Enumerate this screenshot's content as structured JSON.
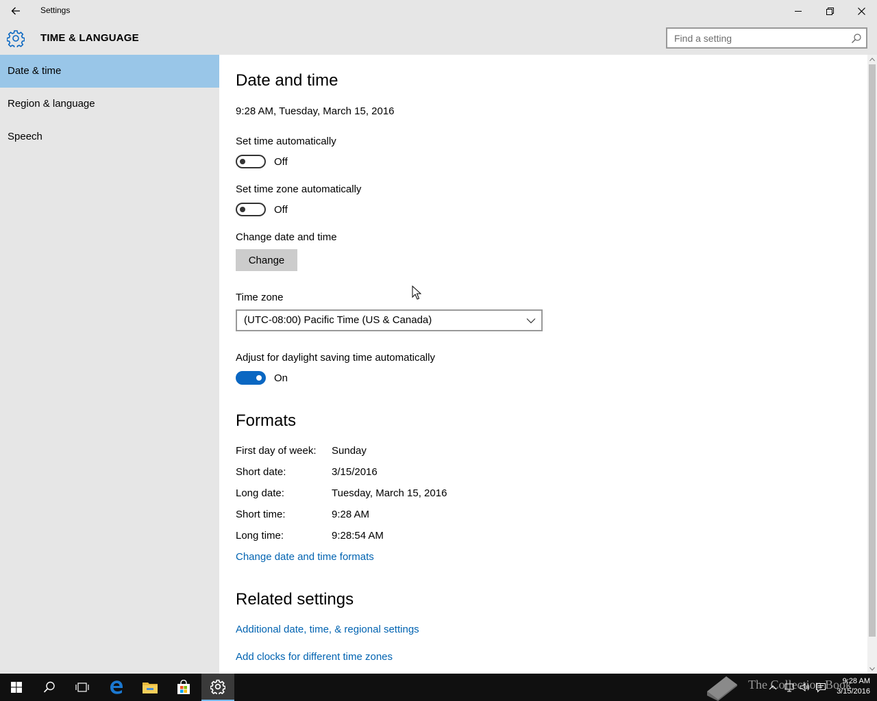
{
  "window": {
    "title": "Settings"
  },
  "header": {
    "section_title": "TIME & LANGUAGE",
    "search_placeholder": "Find a setting"
  },
  "sidebar": {
    "items": [
      {
        "label": "Date & time",
        "selected": true
      },
      {
        "label": "Region & language",
        "selected": false
      },
      {
        "label": "Speech",
        "selected": false
      }
    ]
  },
  "main": {
    "heading": "Date and time",
    "current_datetime": "9:28 AM, Tuesday, March 15, 2016",
    "set_time_auto": {
      "label": "Set time automatically",
      "state": "Off"
    },
    "set_tz_auto": {
      "label": "Set time zone automatically",
      "state": "Off"
    },
    "change_dt": {
      "label": "Change date and time",
      "button": "Change"
    },
    "time_zone": {
      "label": "Time zone",
      "value": "(UTC-08:00) Pacific Time (US & Canada)"
    },
    "dst": {
      "label": "Adjust for daylight saving time automatically",
      "state": "On"
    },
    "formats": {
      "heading": "Formats",
      "rows": [
        {
          "label": "First day of week:",
          "value": "Sunday"
        },
        {
          "label": "Short date:",
          "value": "3/15/2016"
        },
        {
          "label": "Long date:",
          "value": "Tuesday, March 15, 2016"
        },
        {
          "label": "Short time:",
          "value": "9:28 AM"
        },
        {
          "label": "Long time:",
          "value": "9:28:54 AM"
        }
      ],
      "link": "Change date and time formats"
    },
    "related": {
      "heading": "Related settings",
      "links": [
        "Additional date, time, & regional settings",
        "Add clocks for different time zones"
      ]
    }
  },
  "taskbar": {
    "clock_time": "9:28 AM",
    "clock_date": "3/15/2016",
    "watermark": "The Collection Book"
  },
  "colors": {
    "accent": "#0a67c2",
    "link": "#0063b1",
    "selected_nav": "#99c6e8",
    "chrome": "#e6e6e6",
    "taskbar": "#101010"
  }
}
